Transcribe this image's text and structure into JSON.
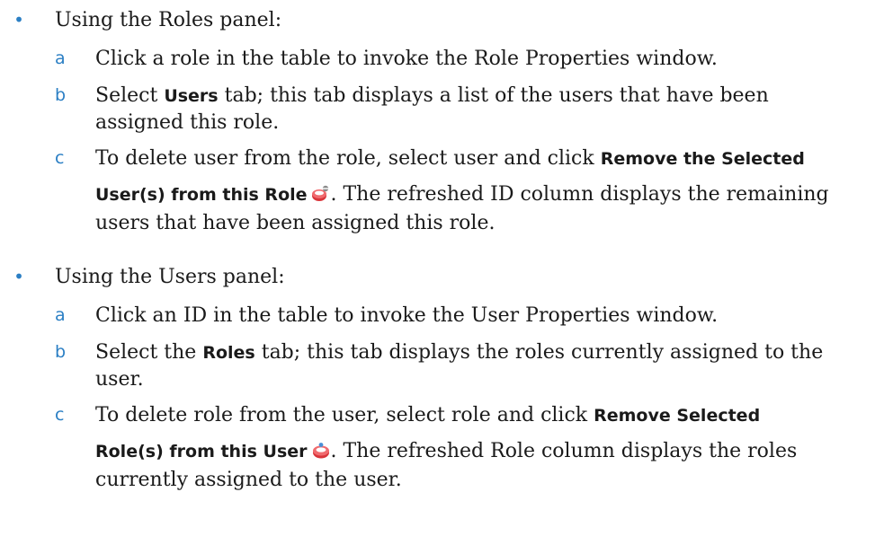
{
  "section1": {
    "bullet_glyph": "•",
    "intro": "Using the Roles panel:",
    "steps": [
      {
        "letter": "a",
        "text": "Click a role in the table to invoke the Role Properties window."
      },
      {
        "letter": "b",
        "pre": "Select ",
        "bold": "Users",
        "post": " tab; this tab displays a list of the users that have been assigned this role."
      },
      {
        "letter": "c",
        "pre": "To delete user from the role, select user and click ",
        "bold_line1": "Remove the Selected",
        "bold_line2": "User(s) from this Role",
        "icon": "remove-user-from-role-icon",
        "post": ". The refreshed ID column displays the remaining users that have been assigned this role."
      }
    ]
  },
  "section2": {
    "bullet_glyph": "•",
    "intro": "Using the Users panel:",
    "steps": [
      {
        "letter": "a",
        "text": "Click an ID in the table to invoke the User Properties window."
      },
      {
        "letter": "b",
        "pre": "Select the ",
        "bold": "Roles",
        "post": " tab; this tab displays the roles currently assigned to the user."
      },
      {
        "letter": "c",
        "pre": "To delete role from the user, select role and click ",
        "bold_line1": "Remove Selected",
        "bold_line2": "Role(s) from this User",
        "icon": "remove-role-from-user-icon",
        "post": ". The refreshed Role column displays the roles currently assigned to the user."
      }
    ]
  },
  "colors": {
    "accent": "#2b7fc4",
    "text": "#1a1a1a",
    "icon_red": "#d9343a"
  }
}
